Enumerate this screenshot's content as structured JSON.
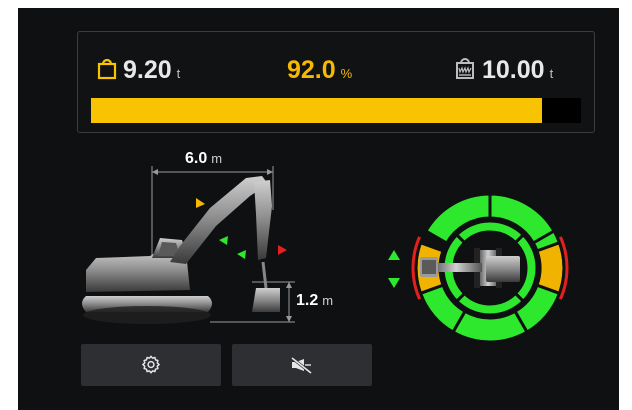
{
  "load": {
    "current_value": "9.20",
    "current_unit": "t",
    "percent_value": "92.0",
    "percent_unit": "%",
    "max_value": "10.00",
    "max_unit": "t",
    "fill_fraction": 0.92
  },
  "dimensions": {
    "reach_value": "6.0",
    "reach_unit": "m",
    "height_value": "1.2",
    "height_unit": "m"
  },
  "colors": {
    "accent": "#f8c300",
    "safe": "#2ee82e",
    "warning": "#f0b400",
    "danger": "#e32020",
    "background": "#0f1011"
  },
  "icons": {
    "current_load": "weight-icon",
    "max_load": "max-capacity-icon",
    "settings": "gear-icon",
    "mute": "mute-alarm-icon"
  }
}
